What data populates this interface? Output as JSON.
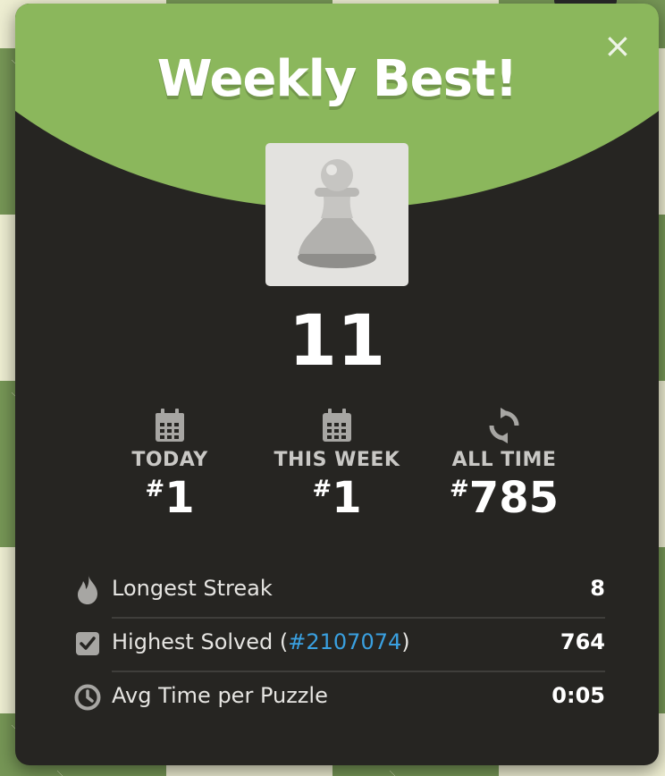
{
  "modal": {
    "title": "Weekly Best!",
    "close_label": "×",
    "score": "11"
  },
  "ranks": [
    {
      "label": "TODAY",
      "hash": "#",
      "value": "1",
      "icon": "calendar-icon"
    },
    {
      "label": "THIS WEEK",
      "hash": "#",
      "value": "1",
      "icon": "calendar-icon"
    },
    {
      "label": "ALL TIME",
      "hash": "#",
      "value": "785",
      "icon": "refresh-icon"
    }
  ],
  "stats": {
    "longest_streak": {
      "label": "Longest Streak",
      "value": "8",
      "icon": "flame-icon"
    },
    "highest_solved": {
      "label_prefix": "Highest Solved (",
      "link": "#2107074",
      "label_suffix": ")",
      "value": "764",
      "icon": "checkbox-icon"
    },
    "avg_time": {
      "label": "Avg Time per Puzzle",
      "value": "0:05",
      "icon": "clock-icon"
    }
  },
  "colors": {
    "header_green": "#8bb75c",
    "modal_bg": "#262522",
    "link_blue": "#3aa0e0"
  }
}
